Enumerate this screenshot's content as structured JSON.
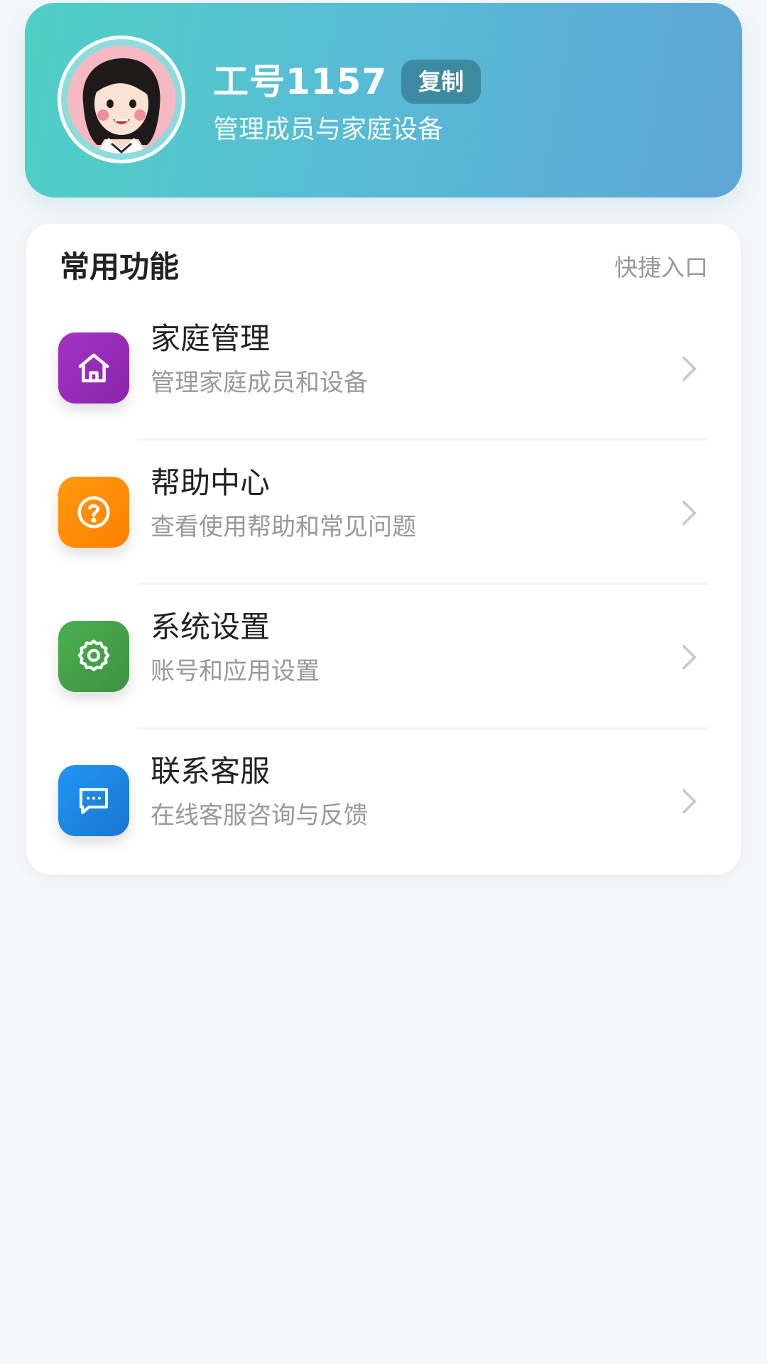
{
  "profile": {
    "name": "工号1157",
    "copy_label": "复制",
    "subtitle": "管理成员与家庭设备",
    "avatar_icon": "avatar-woman"
  },
  "section": {
    "title": "常用功能",
    "hint": "快捷入口"
  },
  "menu": [
    {
      "title": "家庭管理",
      "desc": "管理家庭成员和设备",
      "icon": "home-icon",
      "color": "#9a2fb8"
    },
    {
      "title": "帮助中心",
      "desc": "查看使用帮助和常见问题",
      "icon": "help-icon",
      "color": "#ff8a00"
    },
    {
      "title": "系统设置",
      "desc": "账号和应用设置",
      "icon": "gear-icon",
      "color": "#43a047"
    },
    {
      "title": "联系客服",
      "desc": "在线客服咨询与反馈",
      "icon": "chat-icon",
      "color": "#1e88e5"
    }
  ]
}
